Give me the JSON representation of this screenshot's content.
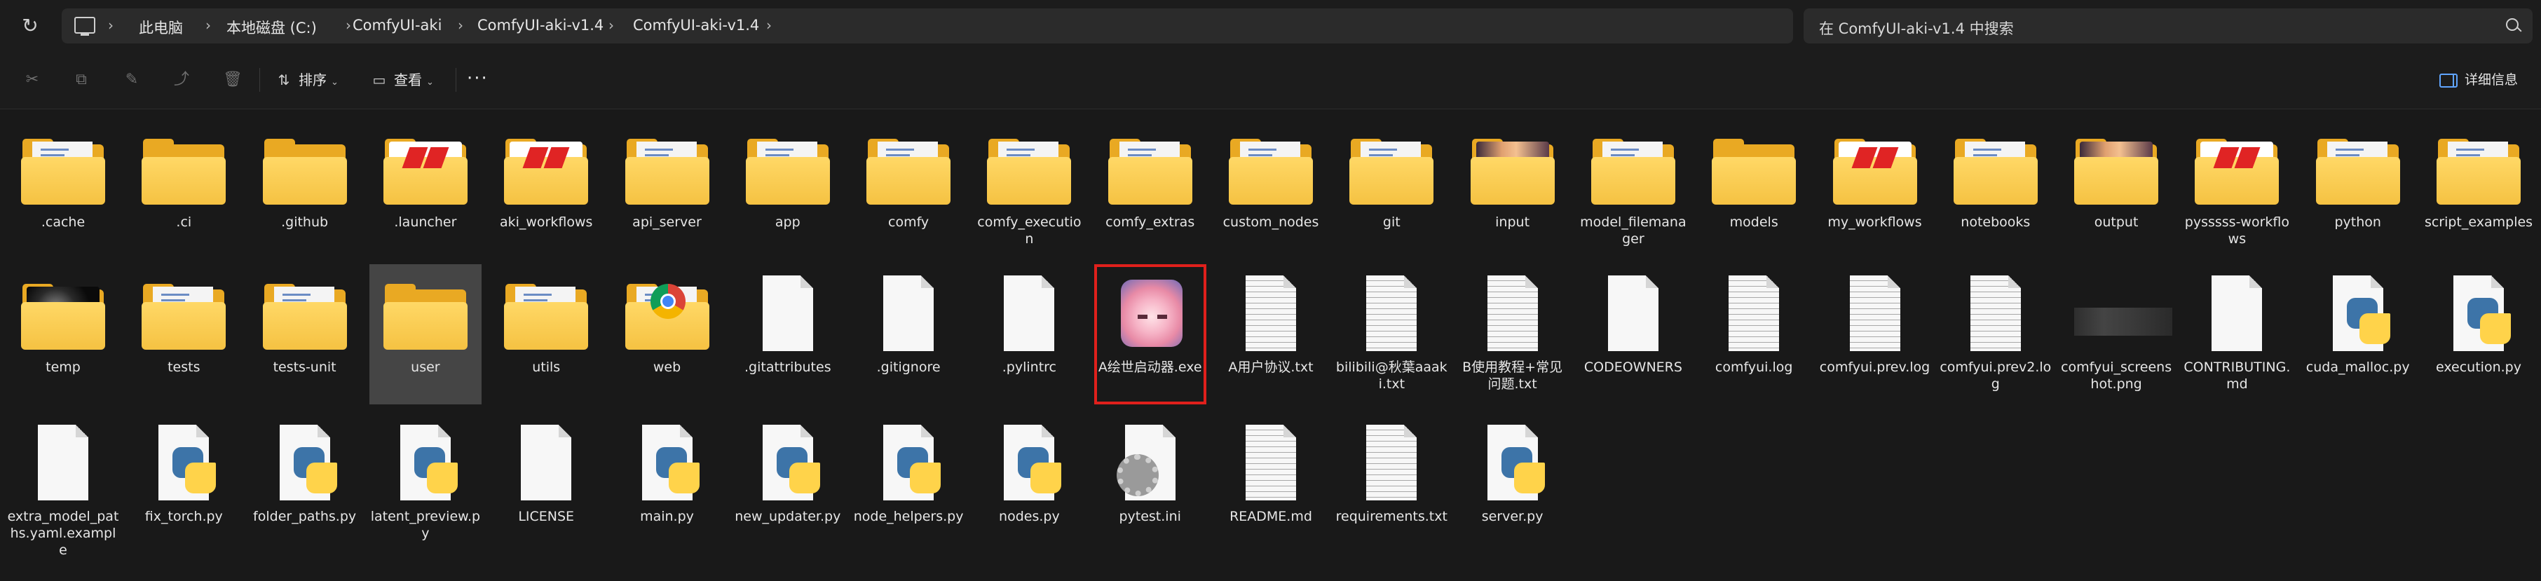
{
  "address_bar": {
    "breadcrumbs": [
      "此电脑",
      "本地磁盘 (C:)",
      "ComfyUI-aki",
      "ComfyUI-aki-v1.4",
      "ComfyUI-aki-v1.4"
    ],
    "search_placeholder": "在 ComfyUI-aki-v1.4 中搜索"
  },
  "toolbar": {
    "sort_label": "排序",
    "view_label": "查看",
    "more_label": "···",
    "details_label": "详细信息"
  },
  "items": [
    {
      "name": ".cache",
      "type": "folder",
      "icon": "folder-with-files-icon"
    },
    {
      "name": ".ci",
      "type": "folder",
      "icon": "folder-icon"
    },
    {
      "name": ".github",
      "type": "folder",
      "icon": "folder-icon"
    },
    {
      "name": ".launcher",
      "type": "folder",
      "icon": "folder-red-logo-icon"
    },
    {
      "name": "aki_workflows",
      "type": "folder",
      "icon": "folder-red-logo-icon"
    },
    {
      "name": "api_server",
      "type": "folder",
      "icon": "folder-with-files-icon"
    },
    {
      "name": "app",
      "type": "folder",
      "icon": "folder-with-files-icon"
    },
    {
      "name": "comfy",
      "type": "folder",
      "icon": "folder-with-files-icon"
    },
    {
      "name": "comfy_execution",
      "type": "folder",
      "icon": "folder-with-files-icon"
    },
    {
      "name": "comfy_extras",
      "type": "folder",
      "icon": "folder-with-files-icon"
    },
    {
      "name": "custom_nodes",
      "type": "folder",
      "icon": "folder-with-files-icon"
    },
    {
      "name": "git",
      "type": "folder",
      "icon": "folder-with-files-icon"
    },
    {
      "name": "input",
      "type": "folder",
      "icon": "folder-image-icon"
    },
    {
      "name": "model_filemanager",
      "type": "folder",
      "icon": "folder-with-files-icon"
    },
    {
      "name": "models",
      "type": "folder",
      "icon": "folder-icon"
    },
    {
      "name": "my_workflows",
      "type": "folder",
      "icon": "folder-red-logo-icon"
    },
    {
      "name": "notebooks",
      "type": "folder",
      "icon": "folder-with-files-icon"
    },
    {
      "name": "output",
      "type": "folder",
      "icon": "folder-image-icon"
    },
    {
      "name": "pysssss-workflows",
      "type": "folder",
      "icon": "folder-red-logo-icon"
    },
    {
      "name": "python",
      "type": "folder",
      "icon": "folder-with-files-icon"
    },
    {
      "name": "script_examples",
      "type": "folder",
      "icon": "folder-with-files-icon"
    },
    {
      "name": "temp",
      "type": "folder",
      "icon": "folder-dark-image-icon"
    },
    {
      "name": "tests",
      "type": "folder",
      "icon": "folder-with-files-icon"
    },
    {
      "name": "tests-unit",
      "type": "folder",
      "icon": "folder-with-files-icon"
    },
    {
      "name": "user",
      "type": "folder",
      "icon": "folder-icon",
      "selected": true
    },
    {
      "name": "utils",
      "type": "folder",
      "icon": "folder-with-files-icon"
    },
    {
      "name": "web",
      "type": "folder",
      "icon": "folder-chrome-icon"
    },
    {
      "name": ".gitattributes",
      "type": "file",
      "icon": "blank-file-icon"
    },
    {
      "name": ".gitignore",
      "type": "file",
      "icon": "blank-file-icon"
    },
    {
      "name": ".pylintrc",
      "type": "file",
      "icon": "blank-file-icon"
    },
    {
      "name": "A绘世启动器.exe",
      "type": "exe",
      "icon": "app-launcher-icon",
      "highlighted": true
    },
    {
      "name": "A用户协议.txt",
      "type": "text",
      "icon": "text-file-icon"
    },
    {
      "name": "bilibili@秋葉aaaki.txt",
      "type": "text",
      "icon": "text-file-icon"
    },
    {
      "name": "B使用教程+常见问题.txt",
      "type": "text",
      "icon": "text-file-icon"
    },
    {
      "name": "CODEOWNERS",
      "type": "file",
      "icon": "blank-file-icon"
    },
    {
      "name": "comfyui.log",
      "type": "text",
      "icon": "text-file-icon"
    },
    {
      "name": "comfyui.prev.log",
      "type": "text",
      "icon": "text-file-icon"
    },
    {
      "name": "comfyui.prev2.log",
      "type": "text",
      "icon": "text-file-icon"
    },
    {
      "name": "comfyui_screenshot.png",
      "type": "image",
      "icon": "image-thumbnail-icon"
    },
    {
      "name": "CONTRIBUTING.md",
      "type": "file",
      "icon": "blank-file-icon"
    },
    {
      "name": "cuda_malloc.py",
      "type": "python",
      "icon": "python-file-icon"
    },
    {
      "name": "execution.py",
      "type": "python",
      "icon": "python-file-icon"
    },
    {
      "name": "extra_model_paths.yaml.example",
      "type": "file",
      "icon": "blank-file-icon"
    },
    {
      "name": "fix_torch.py",
      "type": "python",
      "icon": "python-file-icon"
    },
    {
      "name": "folder_paths.py",
      "type": "python",
      "icon": "python-file-icon"
    },
    {
      "name": "latent_preview.py",
      "type": "python",
      "icon": "python-file-icon"
    },
    {
      "name": "LICENSE",
      "type": "file",
      "icon": "blank-file-icon"
    },
    {
      "name": "main.py",
      "type": "python",
      "icon": "python-file-icon"
    },
    {
      "name": "new_updater.py",
      "type": "python",
      "icon": "python-file-icon"
    },
    {
      "name": "node_helpers.py",
      "type": "python",
      "icon": "python-file-icon"
    },
    {
      "name": "nodes.py",
      "type": "python",
      "icon": "python-file-icon"
    },
    {
      "name": "pytest.ini",
      "type": "config",
      "icon": "config-file-icon"
    },
    {
      "name": "README.md",
      "type": "text",
      "icon": "text-file-icon"
    },
    {
      "name": "requirements.txt",
      "type": "text",
      "icon": "text-file-icon"
    },
    {
      "name": "server.py",
      "type": "python",
      "icon": "python-file-icon"
    }
  ]
}
